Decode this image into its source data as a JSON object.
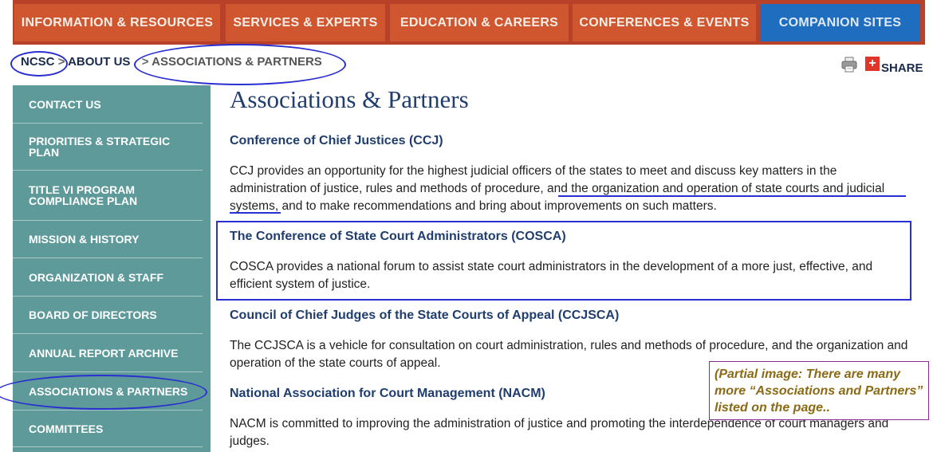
{
  "topnav": {
    "items": [
      {
        "label": "INFORMATION & RESOURCES"
      },
      {
        "label": "SERVICES & EXPERTS"
      },
      {
        "label": "EDUCATION & CAREERS"
      },
      {
        "label": "CONFERENCES & EVENTS"
      },
      {
        "label": "COMPANION SITES"
      }
    ],
    "colors": {
      "bar": "#b8412a",
      "tab": "#d0562f",
      "companion": "#1f6dbe"
    }
  },
  "breadcrumb": {
    "home": "NCSC",
    "sep": ">",
    "parent": "ABOUT US",
    "current": "ASSOCIATIONS & PARTNERS"
  },
  "share": {
    "label": "SHARE",
    "plus": "+",
    "print_icon": "printer-icon"
  },
  "sidebar": {
    "items": [
      {
        "label": "CONTACT US"
      },
      {
        "label": "PRIORITIES & STRATEGIC PLAN"
      },
      {
        "label": "TITLE VI PROGRAM COMPLIANCE PLAN"
      },
      {
        "label": "MISSION & HISTORY"
      },
      {
        "label": "ORGANIZATION & STAFF"
      },
      {
        "label": "BOARD OF DIRECTORS"
      },
      {
        "label": "ANNUAL REPORT ARCHIVE"
      },
      {
        "label": "ASSOCIATIONS & PARTNERS"
      },
      {
        "label": "COMMITTEES"
      }
    ],
    "color": "#5e9a9a"
  },
  "main": {
    "title": "Associations & Partners",
    "sections": [
      {
        "heading": "Conference of Chief Justices (CCJ)",
        "description": "CCJ provides an opportunity for the highest judicial officers of the states to meet and discuss key matters in the administration of justice, rules and methods of procedure, and the organization and operation of state courts and judicial systems, and to make recommendations and bring about improvements on such matters."
      },
      {
        "heading": "The Conference of State Court Administrators (COSCA)",
        "description": "COSCA provides a national forum to assist state court administrators in the development of a more just, effective, and efficient system of justice."
      },
      {
        "heading": "Council of Chief Judges of the State Courts of Appeal (CCJSCA)",
        "description": "The CCJSCA is a vehicle for consultation on court administration, rules and methods of procedure, and the organization and operation of the state courts of appeal."
      },
      {
        "heading": "National Association for Court Management (NACM)",
        "description": "NACM is committed to improving the administration of justice and promoting the interdependence of court managers and judges."
      }
    ]
  },
  "annotation_note": "(Partial image: There are many more “Associations and Partners” listed on the page..",
  "annotation_color": "#2a2fd0"
}
